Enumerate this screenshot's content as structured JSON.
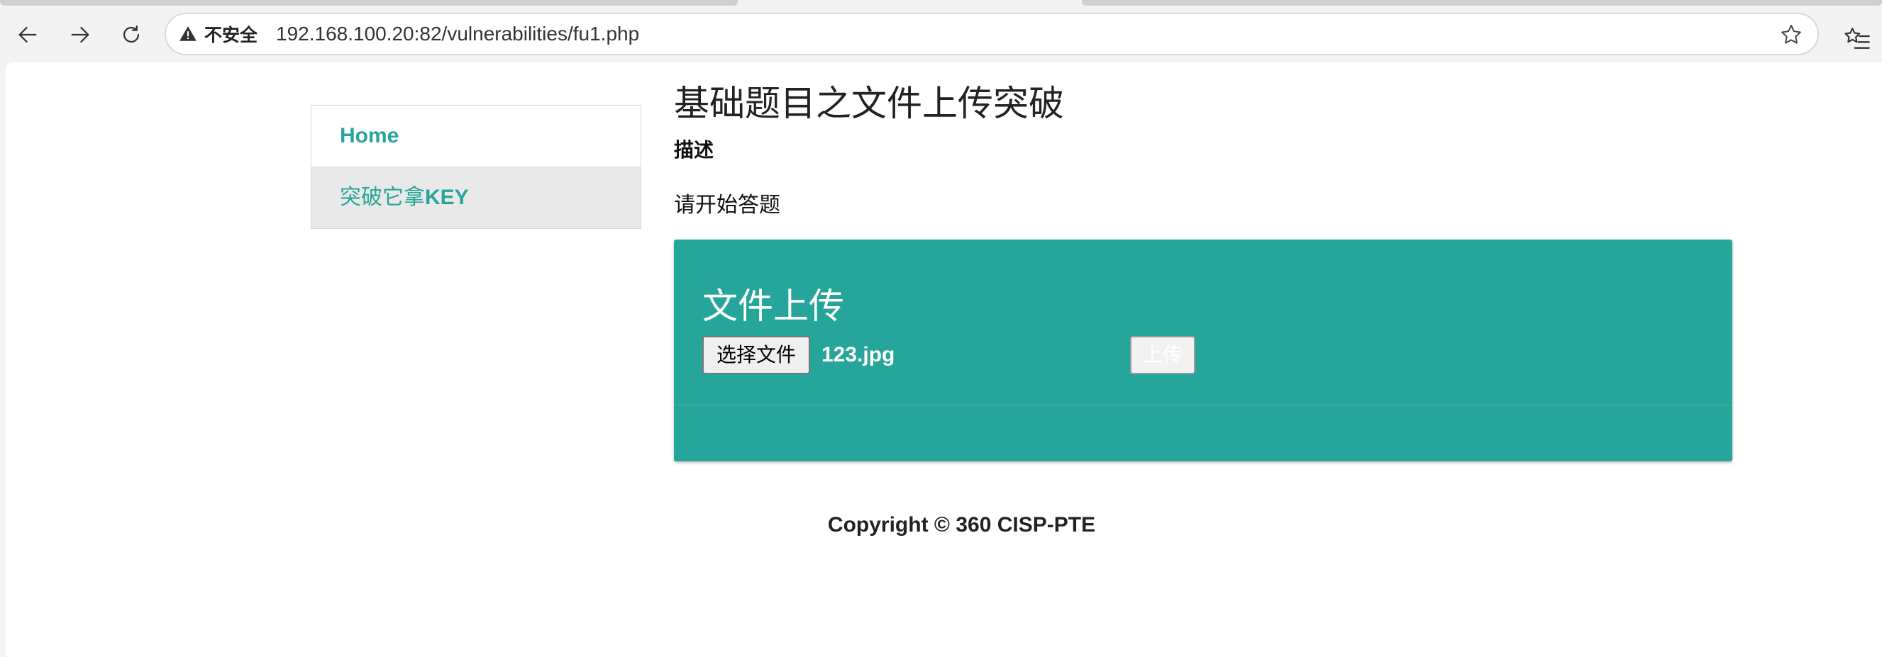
{
  "browser": {
    "security_label": "不安全",
    "url": "192.168.100.20:82/vulnerabilities/fu1.php",
    "icons": [
      "back-icon",
      "forward-icon",
      "reload-icon",
      "warning-icon",
      "star-icon",
      "favorites-list-icon"
    ]
  },
  "sidebar": {
    "items": [
      {
        "label": "Home"
      },
      {
        "label_prefix": "突破它拿",
        "label_suffix": "KEY"
      }
    ]
  },
  "main": {
    "title": "基础题目之文件上传突破",
    "description_heading": "描述",
    "description_text": "请开始答题"
  },
  "upload_card": {
    "title": "文件上传",
    "choose_file_label": "选择文件",
    "file_name": "123.jpg",
    "upload_label": "上传",
    "color": "#26a69a"
  },
  "footer": {
    "copyright": "Copyright © 360 CISP-PTE"
  }
}
